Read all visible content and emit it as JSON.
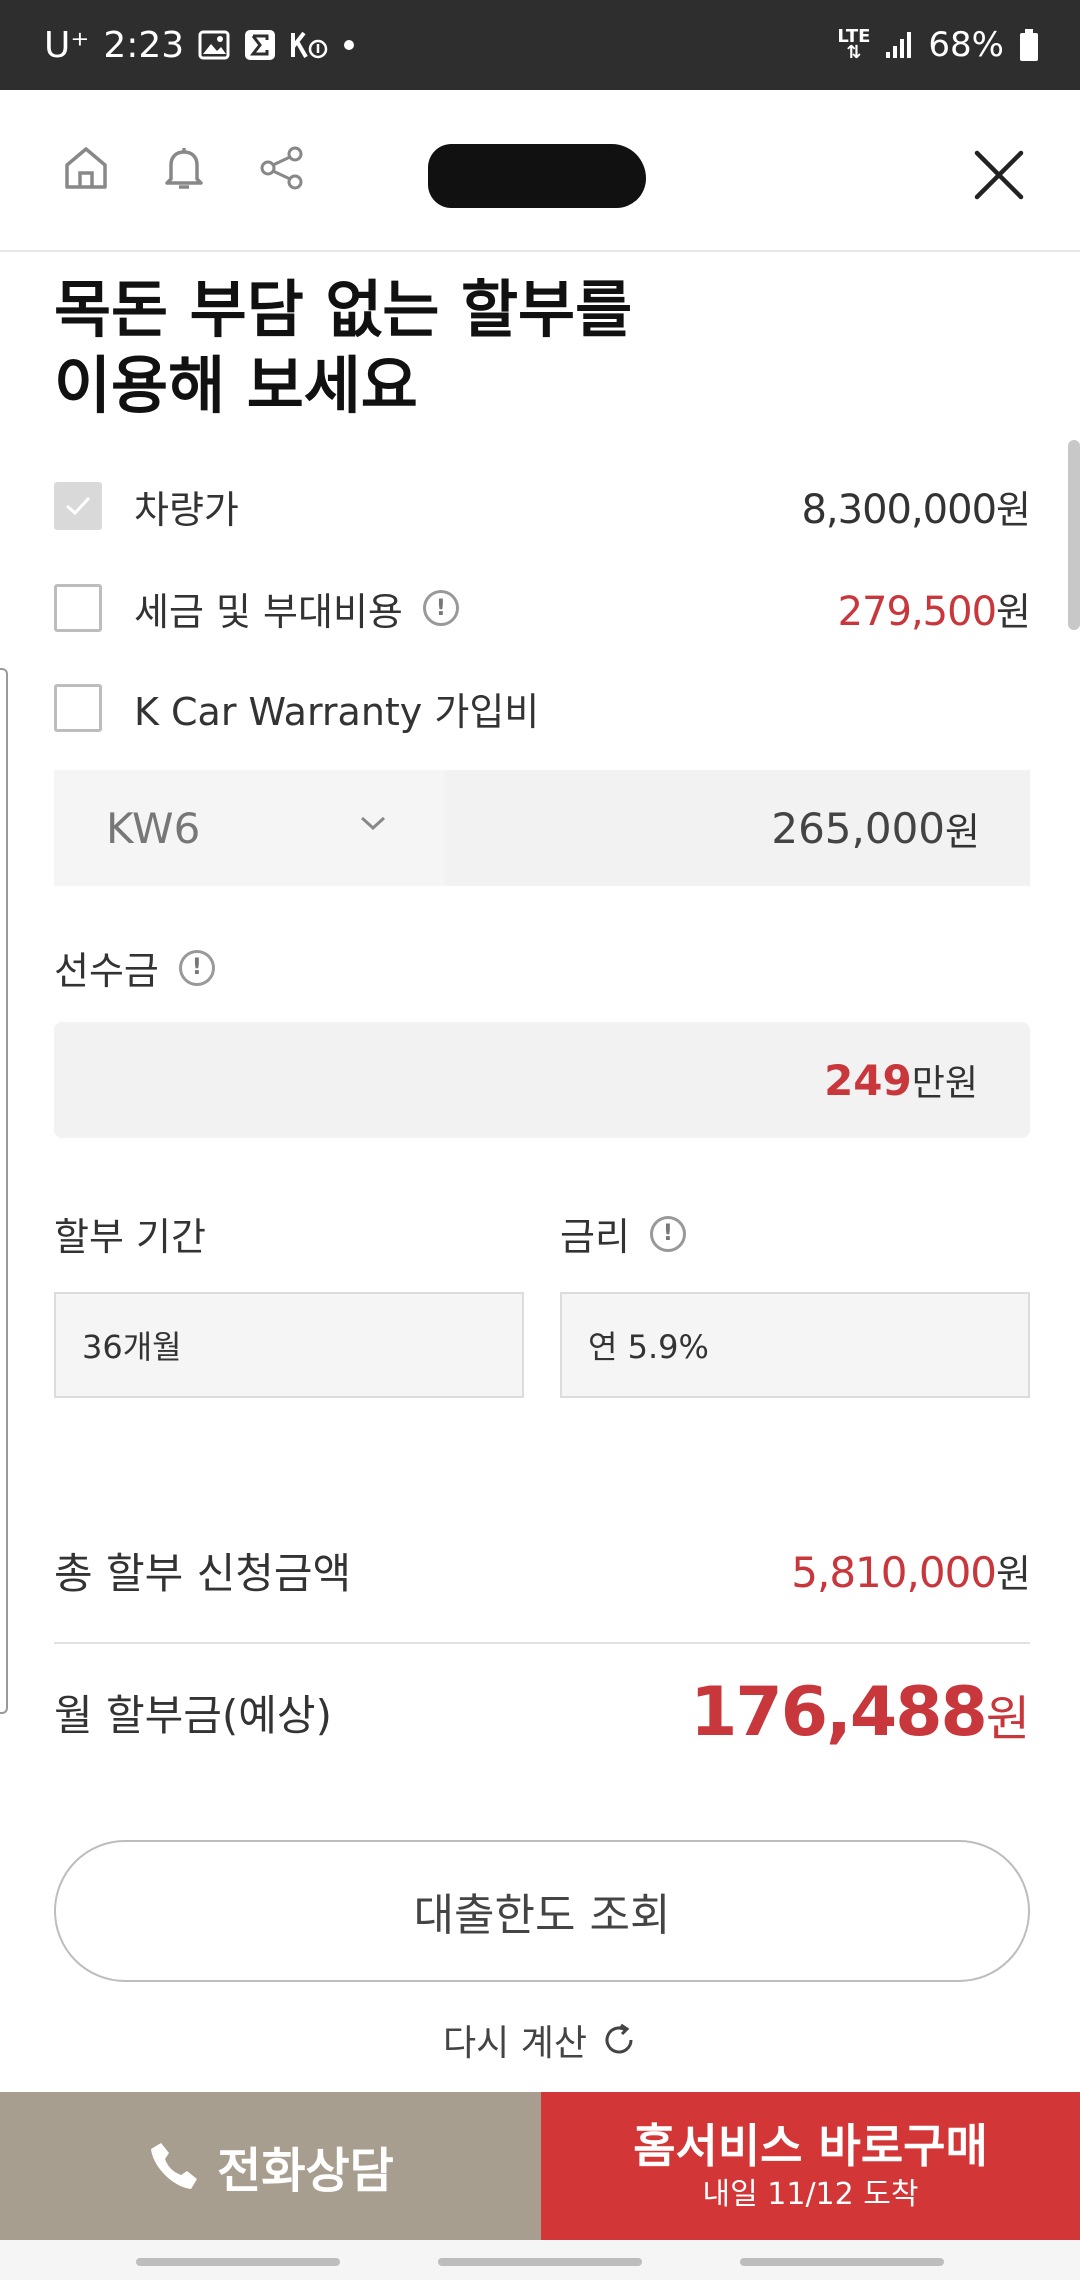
{
  "status_bar": {
    "carrier": "U⁺",
    "time": "2:23",
    "network": "LTE",
    "battery": "68%"
  },
  "nav": {
    "icons": [
      "home-icon",
      "bell-icon",
      "share-icon",
      "close-icon"
    ]
  },
  "title": "목돈 부담 없는 할부를\n이용해 보세요",
  "items": {
    "vehicle": {
      "label": "차량가",
      "value": "8,300,000",
      "unit": "원",
      "checked": true
    },
    "tax": {
      "label": "세금 및 부대비용",
      "value": "279,500",
      "unit": "원",
      "checked": false
    },
    "warranty": {
      "label": "K Car Warranty 가입비",
      "checked": false
    }
  },
  "warranty_plan": {
    "selected": "KW6",
    "amount": "265,000",
    "unit": "원"
  },
  "deposit": {
    "label": "선수금",
    "value": "249",
    "unit": "만원"
  },
  "period": {
    "label": "할부 기간",
    "value": "36개월"
  },
  "rate": {
    "label": "금리",
    "value": "연 5.9%"
  },
  "summary": {
    "total_label": "총 할부 신청금액",
    "total_value": "5,810,000",
    "total_unit": "원",
    "monthly_label": "월 할부금(예상)",
    "monthly_value": "176,488",
    "monthly_unit": "원"
  },
  "loan_button": "대출한도 조회",
  "recalc": "다시 계산",
  "bottom": {
    "phone": "전화상담",
    "buy_main": "홈서비스 바로구매",
    "buy_sub": "내일 11/12 도착"
  },
  "colors": {
    "accent": "#c8373b",
    "buy_button": "#d23636",
    "phone_button": "#a89e8f"
  }
}
